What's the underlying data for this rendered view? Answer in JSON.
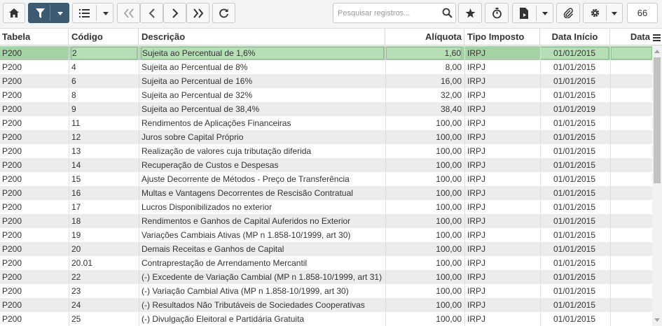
{
  "toolbar": {
    "buttons": [
      {
        "name": "home-icon"
      },
      {
        "name": "filter-icon"
      },
      {
        "name": "list-icon"
      },
      {
        "name": "first-page-icon"
      },
      {
        "name": "previous-page-icon"
      },
      {
        "name": "next-page-icon"
      },
      {
        "name": "last-page-icon"
      },
      {
        "name": "refresh-icon"
      },
      {
        "name": "star-icon"
      },
      {
        "name": "stopwatch-icon"
      },
      {
        "name": "export-file-icon"
      },
      {
        "name": "paperclip-icon"
      },
      {
        "name": "gear-icon"
      }
    ],
    "search_placeholder": "Pesquisar registros...",
    "record_count": "66"
  },
  "table": {
    "columns": {
      "tabela": "Tabela",
      "codigo": "Código",
      "descricao": "Descrição",
      "aliquota": "Alíquota",
      "tipo": "Tipo Imposto",
      "data_inicio": "Data Início",
      "data_fim": "Data"
    },
    "rows": [
      {
        "tabela": "P200",
        "codigo": "2",
        "descricao": "Sujeita ao Percentual de 1,6%",
        "aliquota": "1,60",
        "tipo": "IRPJ",
        "data_inicio": "01/01/2015",
        "selected": true
      },
      {
        "tabela": "P200",
        "codigo": "4",
        "descricao": "Sujeita ao Percentual de 8%",
        "aliquota": "8,00",
        "tipo": "IRPJ",
        "data_inicio": "01/01/2015"
      },
      {
        "tabela": "P200",
        "codigo": "6",
        "descricao": "Sujeita ao Percentual de 16%",
        "aliquota": "16,00",
        "tipo": "IRPJ",
        "data_inicio": "01/01/2015"
      },
      {
        "tabela": "P200",
        "codigo": "8",
        "descricao": "Sujeita ao Percentual de 32%",
        "aliquota": "32,00",
        "tipo": "IRPJ",
        "data_inicio": "01/01/2015"
      },
      {
        "tabela": "P200",
        "codigo": "9",
        "descricao": "Sujeita ao Percentual de 38,4%",
        "aliquota": "38,40",
        "tipo": "IRPJ",
        "data_inicio": "01/01/2019"
      },
      {
        "tabela": "P200",
        "codigo": "11",
        "descricao": "Rendimentos de Aplicações Financeiras",
        "aliquota": "100,00",
        "tipo": "IRPJ",
        "data_inicio": "01/01/2015"
      },
      {
        "tabela": "P200",
        "codigo": "12",
        "descricao": "Juros sobre Capital Próprio",
        "aliquota": "100,00",
        "tipo": "IRPJ",
        "data_inicio": "01/01/2015"
      },
      {
        "tabela": "P200",
        "codigo": "13",
        "descricao": "Realização de valores cuja tributação diferida",
        "aliquota": "100,00",
        "tipo": "IRPJ",
        "data_inicio": "01/01/2015"
      },
      {
        "tabela": "P200",
        "codigo": "14",
        "descricao": "Recuperação de Custos e Despesas",
        "aliquota": "100,00",
        "tipo": "IRPJ",
        "data_inicio": "01/01/2015"
      },
      {
        "tabela": "P200",
        "codigo": "15",
        "descricao": "Ajuste Decorrente de Métodos - Preço de Transferência",
        "aliquota": "100,00",
        "tipo": "IRPJ",
        "data_inicio": "01/01/2015"
      },
      {
        "tabela": "P200",
        "codigo": "16",
        "descricao": "Multas e Vantagens Decorrentes de Rescisão Contratual",
        "aliquota": "100,00",
        "tipo": "IRPJ",
        "data_inicio": "01/01/2015"
      },
      {
        "tabela": "P200",
        "codigo": "17",
        "descricao": "Lucros Disponibilizados no exterior",
        "aliquota": "100,00",
        "tipo": "IRPJ",
        "data_inicio": "01/01/2015"
      },
      {
        "tabela": "P200",
        "codigo": "18",
        "descricao": "Rendimentos e Ganhos de Capital Auferidos no Exterior",
        "aliquota": "100,00",
        "tipo": "IRPJ",
        "data_inicio": "01/01/2015"
      },
      {
        "tabela": "P200",
        "codigo": "19",
        "descricao": "Variações Cambiais Ativas (MP n 1.858-10/1999, art 30)",
        "aliquota": "100,00",
        "tipo": "IRPJ",
        "data_inicio": "01/01/2015"
      },
      {
        "tabela": "P200",
        "codigo": "20",
        "descricao": "Demais Receitas e Ganhos de Capital",
        "aliquota": "100,00",
        "tipo": "IRPJ",
        "data_inicio": "01/01/2015"
      },
      {
        "tabela": "P200",
        "codigo": "20.01",
        "descricao": "Contraprestação de Arrendamento Mercantil",
        "aliquota": "100,00",
        "tipo": "IRPJ",
        "data_inicio": "01/01/2015"
      },
      {
        "tabela": "P200",
        "codigo": "22",
        "descricao": "(-) Excedente de Variação Cambial (MP n 1.858-10/1999, art 31)",
        "aliquota": "100,00",
        "tipo": "IRPJ",
        "data_inicio": "01/01/2015"
      },
      {
        "tabela": "P200",
        "codigo": "23",
        "descricao": "(-) Variação Cambial Ativa (MP n 1.858-10/1999, art 30)",
        "aliquota": "100,00",
        "tipo": "IRPJ",
        "data_inicio": "01/01/2015"
      },
      {
        "tabela": "P200",
        "codigo": "24",
        "descricao": "(-) Resultados Não Tributáveis de Sociedades Cooperativas",
        "aliquota": "100,00",
        "tipo": "IRPJ",
        "data_inicio": "01/01/2015"
      },
      {
        "tabela": "P200",
        "codigo": "25",
        "descricao": "(-) Divulgação Eleitoral e Partidária Gratuita",
        "aliquota": "100,00",
        "tipo": "IRPJ",
        "data_inicio": "01/01/2015"
      }
    ]
  },
  "colors": {
    "selected_row": "#a6d3a6",
    "striped_row": "#ececec",
    "filter_button": "#3d5a73"
  }
}
